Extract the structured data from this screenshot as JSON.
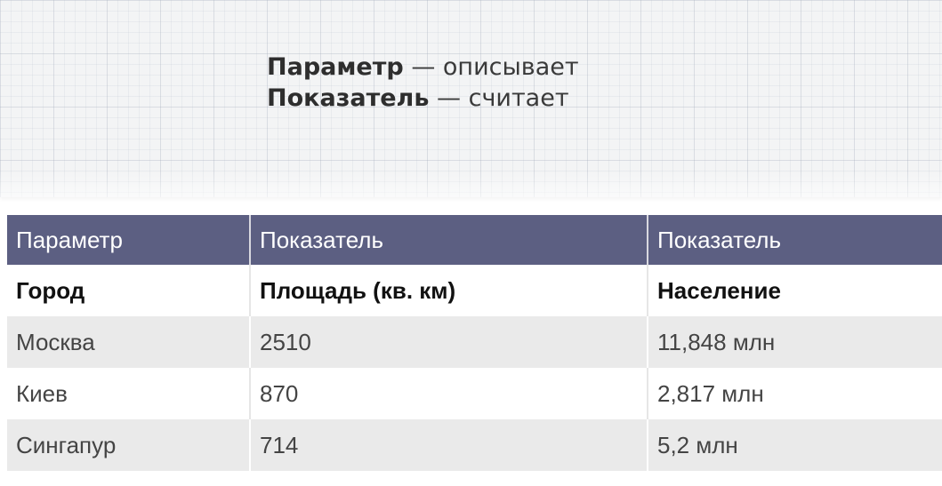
{
  "definitions": [
    {
      "term": "Параметр",
      "separator": " — ",
      "description": "описывает"
    },
    {
      "term": "Показатель",
      "separator": " — ",
      "description": "считает"
    }
  ],
  "table": {
    "header": [
      "Параметр",
      "Показатель",
      "Показатель"
    ],
    "subheader": [
      "Город",
      "Площадь (кв. км)",
      "Население"
    ],
    "rows": [
      [
        "Москва",
        "2510",
        "11,848 млн"
      ],
      [
        "Киев",
        "870",
        "2,817 млн"
      ],
      [
        "Сингапур",
        "714",
        "5,2 млн"
      ]
    ]
  },
  "colors": {
    "header_bg": "#5c5f82",
    "header_text": "#ffffff",
    "stripe_bg": "#eaeaea",
    "grid_bg": "#f3f4f5"
  }
}
